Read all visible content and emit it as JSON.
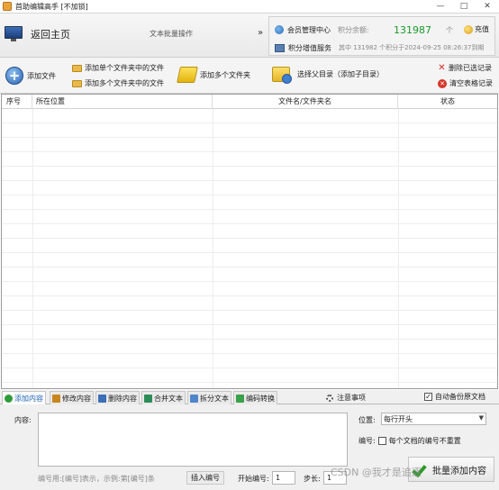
{
  "window": {
    "title": "首助编辑高手 [不加锁]",
    "minimize": "—",
    "maximize": "□",
    "close": "✕"
  },
  "header": {
    "home_label": "返回主页",
    "mode_label": "文本批量操作",
    "chevron": "»",
    "member_center": "会员管理中心",
    "points_label": "积分余额:",
    "points_value": "131987",
    "up_arrow": "个",
    "recharge": "充值",
    "point_service": "积分增值服务",
    "point_status": "其中 131982 个积分于2024-09-25 08:26:37到期"
  },
  "toolbar": {
    "add_file": "添加文件",
    "add_single_folder": "添加单个文件夹中的文件",
    "add_multi_folder": "添加多个文件夹中的文件",
    "add_multi_folders": "添加多个文件夹",
    "select_parent": "选择父目录（添加子目录）",
    "delete_selected": "删除已选记录",
    "clear_table": "清空表格记录"
  },
  "table": {
    "columns": [
      "序号",
      "所在位置",
      "文件名/文件夹名",
      "状态"
    ],
    "rows": []
  },
  "tabs": {
    "items": [
      "添加内容",
      "修改内容",
      "删除内容",
      "合并文本",
      "拆分文本",
      "编码转换"
    ],
    "active": "添加内容",
    "notice": "注意事项",
    "auto_backup": "自动备份原文档",
    "auto_backup_checked": true
  },
  "panel": {
    "content_label": "内容:",
    "content_value": "",
    "position_label": "位置:",
    "position_value": "每行开头",
    "number_label": "编号:",
    "no_repeat_label": "每个文档的编号不重置",
    "no_repeat_checked": false,
    "hint": "编号用:[编号]表示，示例:第[编号]条",
    "insert_number": "插入编号",
    "start_label": "开始编号:",
    "start_value": "1",
    "step_label": "步长:",
    "step_value": "1",
    "execute": "批量添加内容"
  },
  "watermark": "CSDN @我才是追逐"
}
